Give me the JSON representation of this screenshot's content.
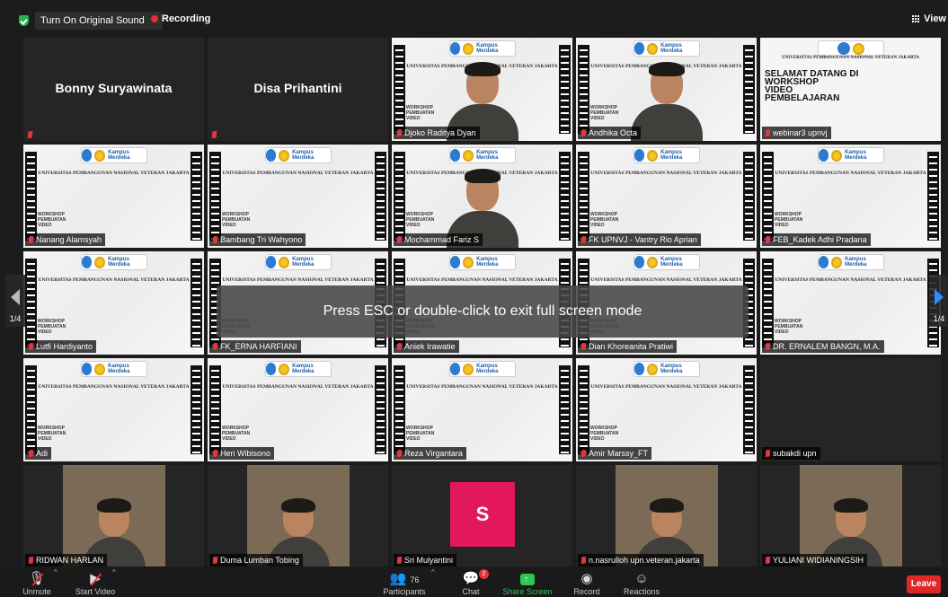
{
  "topbar": {
    "sound_label": "Turn On Original Sound",
    "recording_label": "Recording",
    "view_label": "View"
  },
  "slide": {
    "university": "UNIVERSITAS PEMBANGUNAN NASIONAL VETERAN JAKARTA",
    "logo_text": "Kampus Merdeka",
    "workshop_lines": [
      "WORKSHOP",
      "PEMBUATAN",
      "VIDEO"
    ],
    "welcome_lines": [
      "SELAMAT DATANG DI",
      "WORKSHOP",
      "VIDEO",
      "PEMBELAJARAN"
    ]
  },
  "tiles": [
    {
      "name": "Bonny Suryawinata",
      "kind": "name-only"
    },
    {
      "name": "Disa Prihantini",
      "kind": "name-only"
    },
    {
      "name": "Djoko Raditya Dyan",
      "kind": "person",
      "active": true
    },
    {
      "name": "Andhika Octa",
      "kind": "person"
    },
    {
      "name": "webinar3 upnvj",
      "kind": "welcome"
    },
    {
      "name": "Nanang Alamsyah",
      "kind": "slide"
    },
    {
      "name": "Bambang Tri Wahyono",
      "kind": "slide"
    },
    {
      "name": "Mochammad Fariz S",
      "kind": "person"
    },
    {
      "name": "FK UPNVJ - Vantry Rio Aprian",
      "kind": "slide"
    },
    {
      "name": "FEB_Kadek Adhi Pradana",
      "kind": "slide"
    },
    {
      "name": "Lutfi Hardiyanto",
      "kind": "slide"
    },
    {
      "name": "FK_ERNA HARFIANI",
      "kind": "slide"
    },
    {
      "name": "Aniek Irawatie",
      "kind": "slide"
    },
    {
      "name": "Dian Khoreanita Pratiwi",
      "kind": "slide"
    },
    {
      "name": "DR. ERNALEM BANGN, M.A.",
      "kind": "slide"
    },
    {
      "name": "Adi",
      "kind": "slide"
    },
    {
      "name": "Heri Wibisono",
      "kind": "slide"
    },
    {
      "name": "Reza Virgantara",
      "kind": "slide"
    },
    {
      "name": "Amir Marssy_FT",
      "kind": "slide"
    },
    {
      "name": "subakdi upn",
      "kind": "empty"
    },
    {
      "name": "RIDWAN HARLAN",
      "kind": "photo"
    },
    {
      "name": "Duma Lumban Tobing",
      "kind": "photo"
    },
    {
      "name": "Sri Mulyantini",
      "kind": "avatar",
      "initial": "S"
    },
    {
      "name": "n.nasrulloh upn.veteran.jakarta",
      "kind": "photo"
    },
    {
      "name": "YULIANI WIDIANINGSIH",
      "kind": "photo"
    }
  ],
  "pager": {
    "left": "1/4",
    "right": "1/4"
  },
  "overlay": {
    "text": "Press ESC or double-click to exit full screen mode"
  },
  "toolbar": {
    "unmute": "Unmute",
    "start_video": "Start Video",
    "participants": "Participants",
    "participant_count": "76",
    "chat": "Chat",
    "chat_badge": "2",
    "share_screen": "Share Screen",
    "record": "Record",
    "reactions": "Reactions",
    "leave": "Leave"
  },
  "colors": {
    "accent_green": "#2ec657",
    "active_border": "#b6e35d",
    "leave_red": "#e02828",
    "avatar_pink": "#e2185b"
  }
}
